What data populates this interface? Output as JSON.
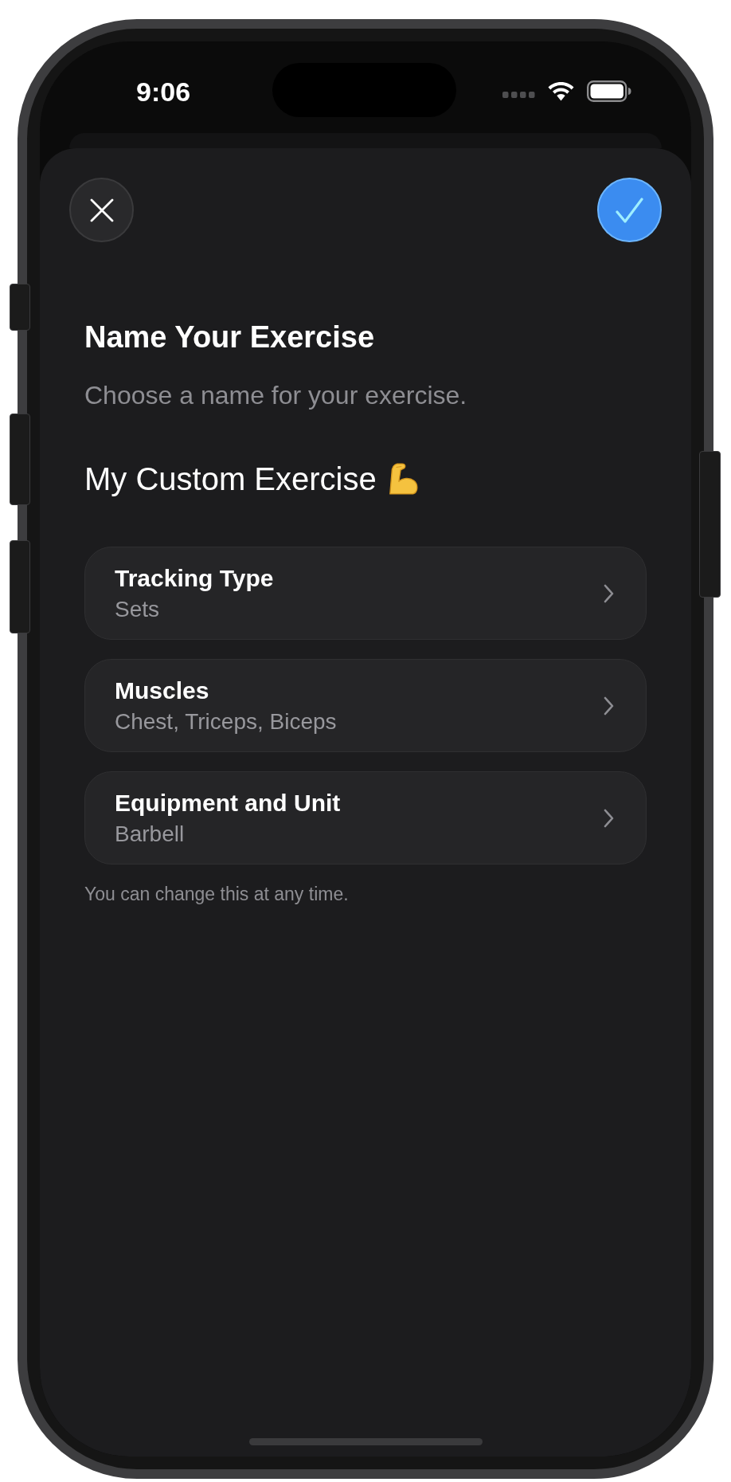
{
  "status_bar": {
    "time": "9:06"
  },
  "title": "Name Your Exercise",
  "subtitle": "Choose a name for your exercise.",
  "name_field": {
    "value": "My Custom Exercise"
  },
  "options": [
    {
      "label": "Tracking Type",
      "value": "Sets"
    },
    {
      "label": "Muscles",
      "value": "Chest, Triceps, Biceps"
    },
    {
      "label": "Equipment and Unit",
      "value": "Barbell"
    }
  ],
  "footnote": "You can change this at any time."
}
